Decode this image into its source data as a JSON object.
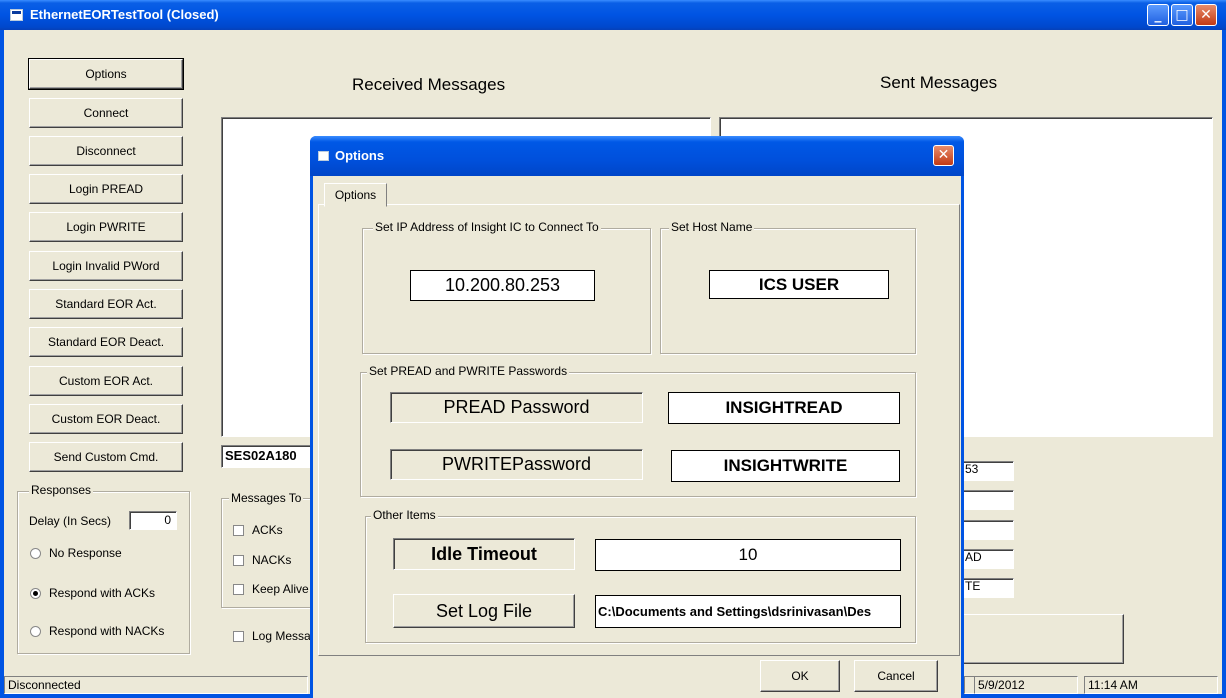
{
  "window": {
    "title": "EthernetEORTestTool (Closed)",
    "minimize": "_",
    "maximize": "□",
    "close": "✕"
  },
  "left_buttons": [
    "Options",
    "Connect",
    "Disconnect",
    "Login PREAD",
    "Login PWRITE",
    "Login Invalid PWord",
    "Standard EOR Act.",
    "Standard EOR Deact.",
    "Custom EOR Act.",
    "Custom EOR Deact.",
    "Send Custom Cmd."
  ],
  "headings": {
    "received": "Received Messages",
    "sent": "Sent Messages"
  },
  "custom_cmd_value": "SES02A180",
  "responses": {
    "group_label": "Responses",
    "delay_label": "Delay (In Secs)",
    "delay_value": "0",
    "options": [
      "No Response",
      "Respond with ACKs",
      "Respond with NACKs"
    ],
    "selected": "Respond with ACKs"
  },
  "messages_to": {
    "group_label": "Messages To",
    "items": [
      "ACKs",
      "NACKs",
      "Keep Alive"
    ]
  },
  "log_messages_label": "Log Messa",
  "right_fields": [
    "53",
    "",
    "",
    "AD",
    "TE"
  ],
  "status": {
    "left": "Disconnected",
    "date": "5/9/2012",
    "time": "11:14 AM"
  },
  "dialog": {
    "title": "Options",
    "tab": "Options",
    "ip_group": "Set IP Address of Insight IC to Connect To",
    "ip_value": "10.200.80.253",
    "host_group": "Set Host Name",
    "host_value": "ICS USER",
    "pw_group": "Set PREAD and PWRITE Passwords",
    "pread_label": "PREAD Password",
    "pread_value": "INSIGHTREAD",
    "pwrite_label": "PWRITEPassword",
    "pwrite_value": "INSIGHTWRITE",
    "other_group": "Other Items",
    "idle_label": "Idle Timeout",
    "idle_value": "10",
    "logfile_button": "Set Log File",
    "logfile_value": "C:\\Documents and Settings\\dsrinivasan\\Des",
    "ok": "OK",
    "cancel": "Cancel"
  }
}
